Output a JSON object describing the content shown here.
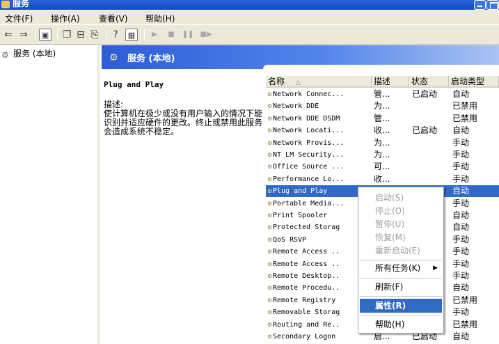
{
  "window": {
    "title": "服务"
  },
  "menubar": [
    {
      "label": "文件(F)"
    },
    {
      "label": "操作(A)"
    },
    {
      "label": "查看(V)"
    },
    {
      "label": "帮助(H)"
    }
  ],
  "toolbar": {
    "icons": [
      "back-icon",
      "forward-icon",
      "up-level-icon",
      "properties-icon",
      "refresh-icon",
      "export-list-icon",
      "help-icon",
      "show-hide-icon",
      "start-icon",
      "stop-icon",
      "pause-icon",
      "restart-icon"
    ]
  },
  "tree": {
    "root_label": "服务 (本地)"
  },
  "header": {
    "title": "服务 (本地)"
  },
  "detail": {
    "service_name": "Plug and Play",
    "desc_label": "描述:",
    "desc_text": "使计算机在极少或没有用户输入的情况下能识别并适应硬件的更改。终止或禁用此服务会造成系统不稳定。"
  },
  "columns": {
    "name": "名称",
    "desc": "描述",
    "status": "状态",
    "startup": "启动类型"
  },
  "services": [
    {
      "name": "Network Connec...",
      "desc": "管...",
      "status": "已启动",
      "startup": "自动"
    },
    {
      "name": "Network DDE",
      "desc": "为...",
      "status": "",
      "startup": "已禁用"
    },
    {
      "name": "Network DDE DSDM",
      "desc": "管...",
      "status": "",
      "startup": "已禁用"
    },
    {
      "name": "Network Locati...",
      "desc": "收...",
      "status": "已启动",
      "startup": "自动"
    },
    {
      "name": "Network Provis...",
      "desc": "为...",
      "status": "",
      "startup": "手动"
    },
    {
      "name": "NT LM Security...",
      "desc": "为...",
      "status": "",
      "startup": "手动"
    },
    {
      "name": "Office Source ...",
      "desc": "可...",
      "status": "",
      "startup": "手动"
    },
    {
      "name": "Performance Lo...",
      "desc": "收...",
      "status": "",
      "startup": "手动"
    },
    {
      "name": "Plug and Play",
      "desc": "",
      "status": "",
      "startup": "自动"
    },
    {
      "name": "Portable Media...",
      "desc": "",
      "status": "",
      "startup": "手动"
    },
    {
      "name": "Print Spooler",
      "desc": "",
      "status": "",
      "startup": "自动"
    },
    {
      "name": "Protected Storag",
      "desc": "",
      "status": "",
      "startup": "自动"
    },
    {
      "name": "QoS RSVP",
      "desc": "",
      "status": "",
      "startup": "手动"
    },
    {
      "name": "Remote Access ..",
      "desc": "",
      "status": "",
      "startup": "手动"
    },
    {
      "name": "Remote Access ..",
      "desc": "",
      "status": "",
      "startup": "手动"
    },
    {
      "name": "Remote Desktop..",
      "desc": "",
      "status": "",
      "startup": "手动"
    },
    {
      "name": "Remote Procedu..",
      "desc": "",
      "status": "",
      "startup": "自动"
    },
    {
      "name": "Remote Registry",
      "desc": "",
      "status": "",
      "startup": "已禁用"
    },
    {
      "name": "Removable Storag",
      "desc": "",
      "status": "",
      "startup": "手动"
    },
    {
      "name": "Routing and Re..",
      "desc": "",
      "status": "",
      "startup": "已禁用"
    },
    {
      "name": "Secondary Logon",
      "desc": "启...",
      "status": "已启动",
      "startup": "自动"
    }
  ],
  "context_menu": {
    "start": "启动(S)",
    "stop": "停止(O)",
    "pause": "暂停(U)",
    "resume": "恢复(M)",
    "restart": "重新启动(E)",
    "all_tasks": "所有任务(K)",
    "refresh": "刷新(F)",
    "properties": "属性(R)",
    "help": "帮助(H)"
  }
}
